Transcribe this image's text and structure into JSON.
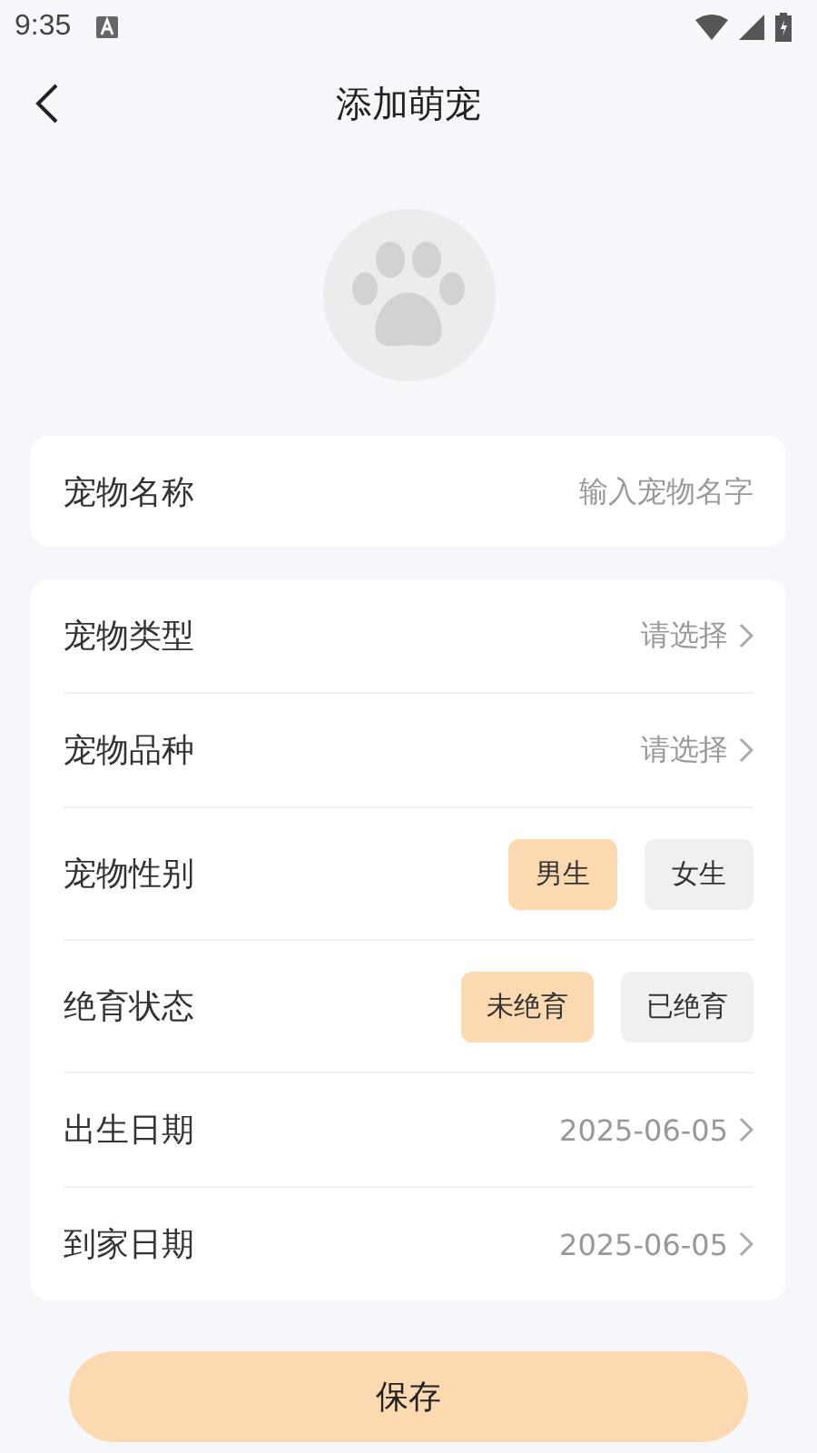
{
  "status_bar": {
    "time": "9:35"
  },
  "header": {
    "title": "添加萌宠"
  },
  "name_card": {
    "label": "宠物名称",
    "placeholder": "输入宠物名字"
  },
  "details": [
    {
      "kind": "select",
      "label": "宠物类型",
      "value": "请选择"
    },
    {
      "kind": "select",
      "label": "宠物品种",
      "value": "请选择"
    },
    {
      "kind": "choice",
      "label": "宠物性别",
      "options": [
        {
          "label": "男生",
          "selected": true
        },
        {
          "label": "女生",
          "selected": false
        }
      ]
    },
    {
      "kind": "choice",
      "label": "绝育状态",
      "options": [
        {
          "label": "未绝育",
          "selected": true
        },
        {
          "label": "已绝育",
          "selected": false
        }
      ]
    },
    {
      "kind": "select",
      "label": "出生日期",
      "value": "2025-06-05"
    },
    {
      "kind": "select",
      "label": "到家日期",
      "value": "2025-06-05"
    }
  ],
  "save_button": {
    "label": "保存"
  }
}
